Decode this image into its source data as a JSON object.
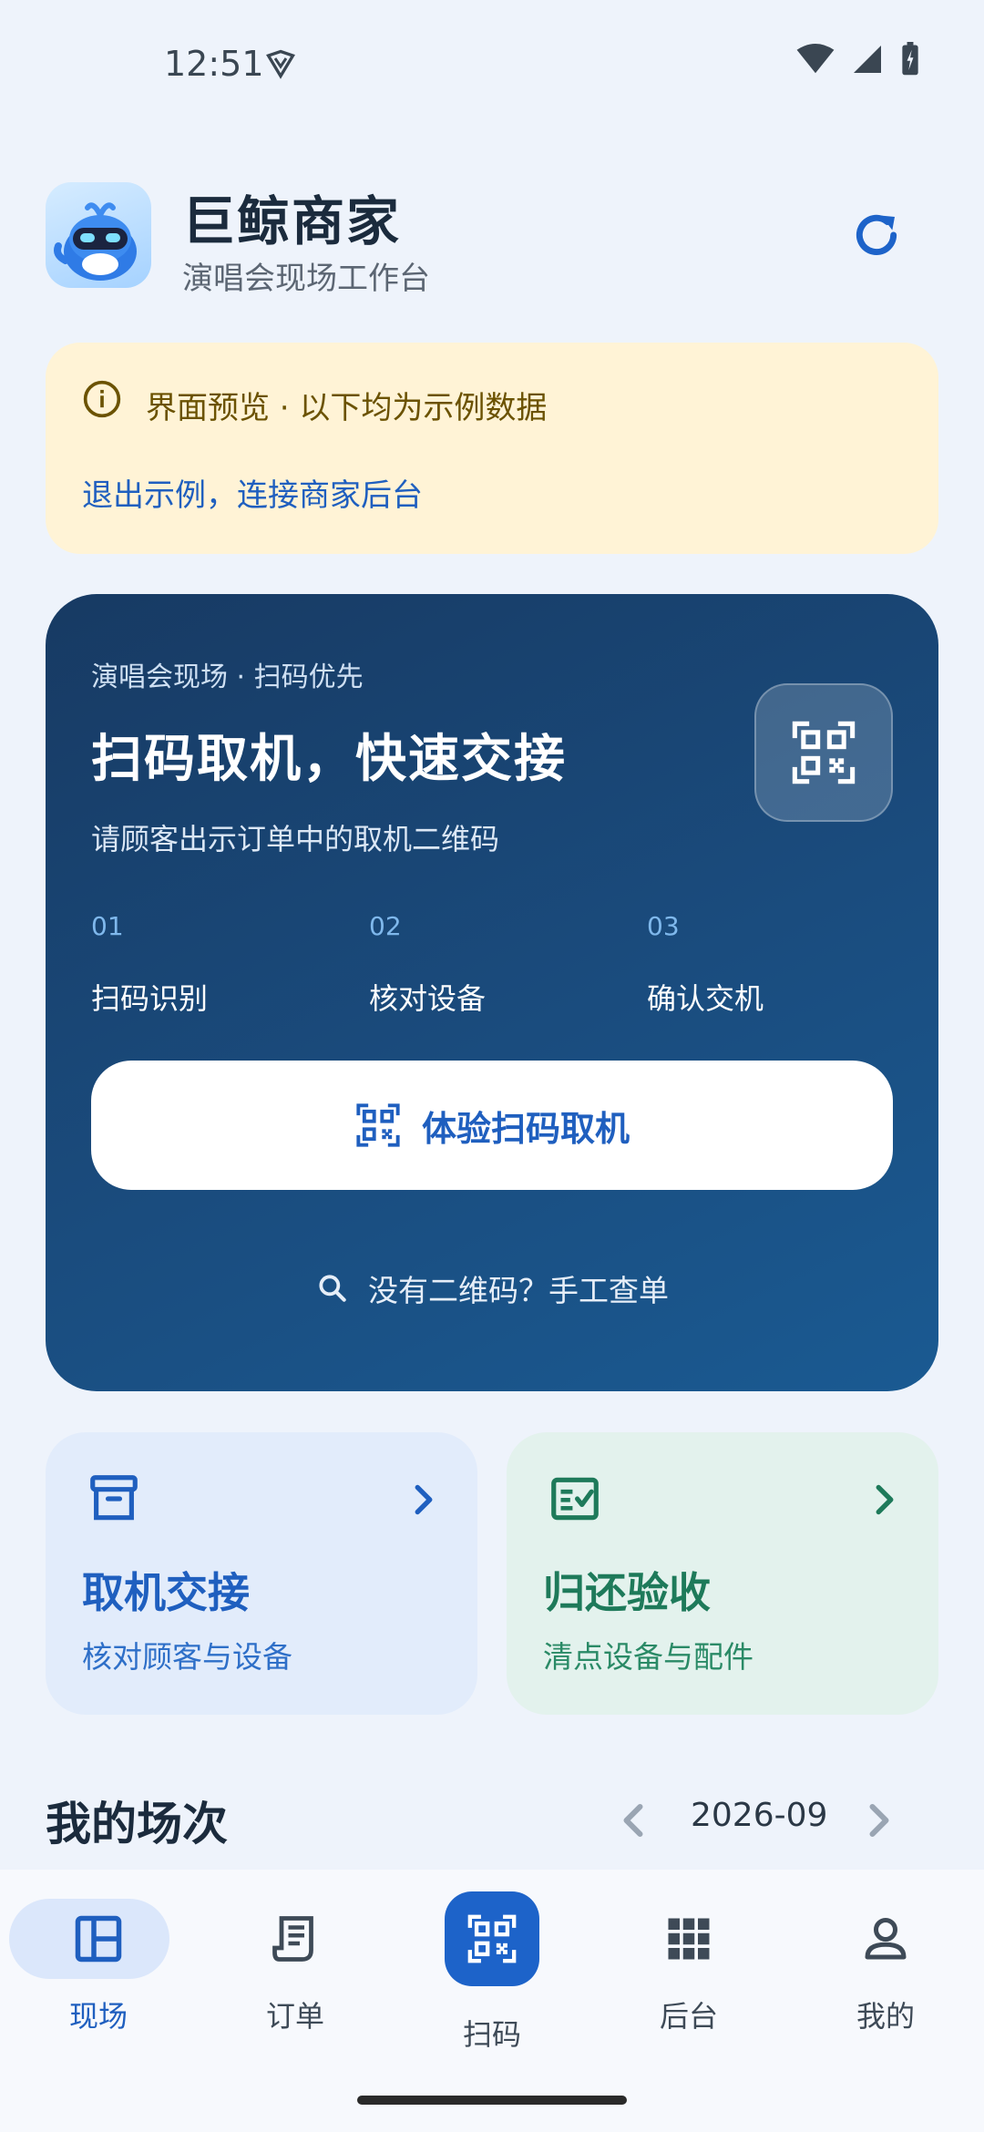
{
  "status": {
    "time": "12:51"
  },
  "header": {
    "title": "巨鲸商家",
    "subtitle": "演唱会现场工作台"
  },
  "notice": {
    "text": "界面预览 · 以下均为示例数据",
    "link": "退出示例，连接商家后台"
  },
  "hero": {
    "kicker": "演唱会现场 · 扫码优先",
    "title": "扫码取机，快速交接",
    "subtitle": "请顾客出示订单中的取机二维码",
    "steps": [
      {
        "no": "01",
        "label": "扫码识别"
      },
      {
        "no": "02",
        "label": "核对设备"
      },
      {
        "no": "03",
        "label": "确认交机"
      }
    ],
    "button": "体验扫码取机",
    "manual_link": "没有二维码？手工查单"
  },
  "cards": [
    {
      "title": "取机交接",
      "subtitle": "核对顾客与设备",
      "color": "#1f5fbf",
      "icon": "archive-box-icon"
    },
    {
      "title": "归还验收",
      "subtitle": "清点设备与配件",
      "color": "#1e7a5a",
      "icon": "checklist-icon"
    }
  ],
  "section": {
    "title": "我的场次",
    "month": "2026-09"
  },
  "nav": [
    {
      "label": "现场",
      "icon": "dashboard-icon",
      "active": true
    },
    {
      "label": "订单",
      "icon": "receipt-icon"
    },
    {
      "label": "扫码",
      "icon": "qr-scan-icon"
    },
    {
      "label": "后台",
      "icon": "apps-grid-icon"
    },
    {
      "label": "我的",
      "icon": "person-icon"
    }
  ],
  "colors": {
    "accent": "#1d63c9",
    "hero_bg": "#173a63",
    "notice_bg": "#fff3d6"
  }
}
